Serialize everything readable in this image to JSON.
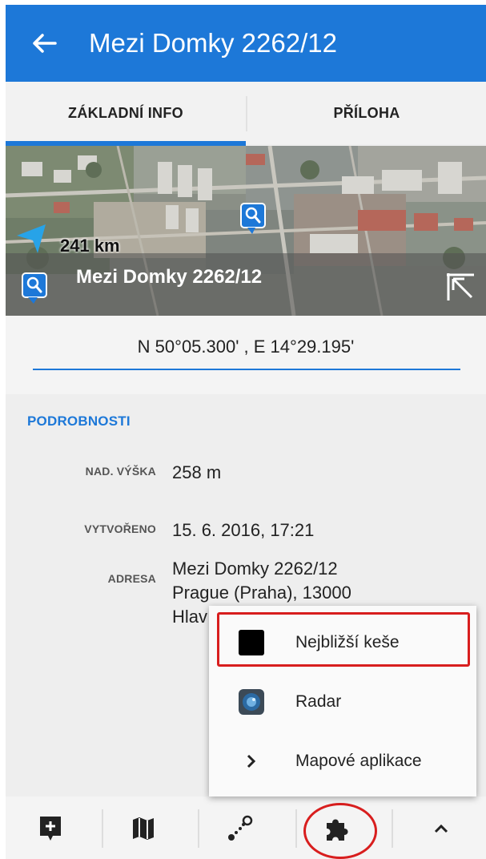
{
  "header": {
    "title": "Mezi Domky 2262/12"
  },
  "tabs": [
    {
      "label": "ZÁKLADNÍ INFO",
      "active": true
    },
    {
      "label": "PŘÍLOHA",
      "active": false
    }
  ],
  "map": {
    "distance": "241 km",
    "place_name": "Mezi Domky 2262/12"
  },
  "coordinates": "N 50°05.300' , E 14°29.195'",
  "details": {
    "section_title": "PODROBNOSTI",
    "elevation_label": "NAD. VÝŠKA",
    "elevation_value": "258 m",
    "created_label": "VYTVOŘENO",
    "created_value": "15. 6. 2016, 17:21",
    "address_label": "ADRESA",
    "address_line1": "Mezi Domky 2262/12",
    "address_line2": "Prague (Praha), 13000",
    "address_line3": "Hlav"
  },
  "menu": {
    "items": [
      {
        "label": "Nejbližší keše",
        "icon": "black-square-icon"
      },
      {
        "label": "Radar",
        "icon": "radar-icon"
      },
      {
        "label": "Mapové aplikace",
        "icon": "chevron-right-icon"
      }
    ]
  },
  "bottom_bar": {
    "icons": [
      "add-note-icon",
      "map-icon",
      "route-icon",
      "puzzle-icon",
      "chevron-up-icon"
    ]
  },
  "colors": {
    "accent": "#1d78d8",
    "highlight": "#d81e1e"
  }
}
